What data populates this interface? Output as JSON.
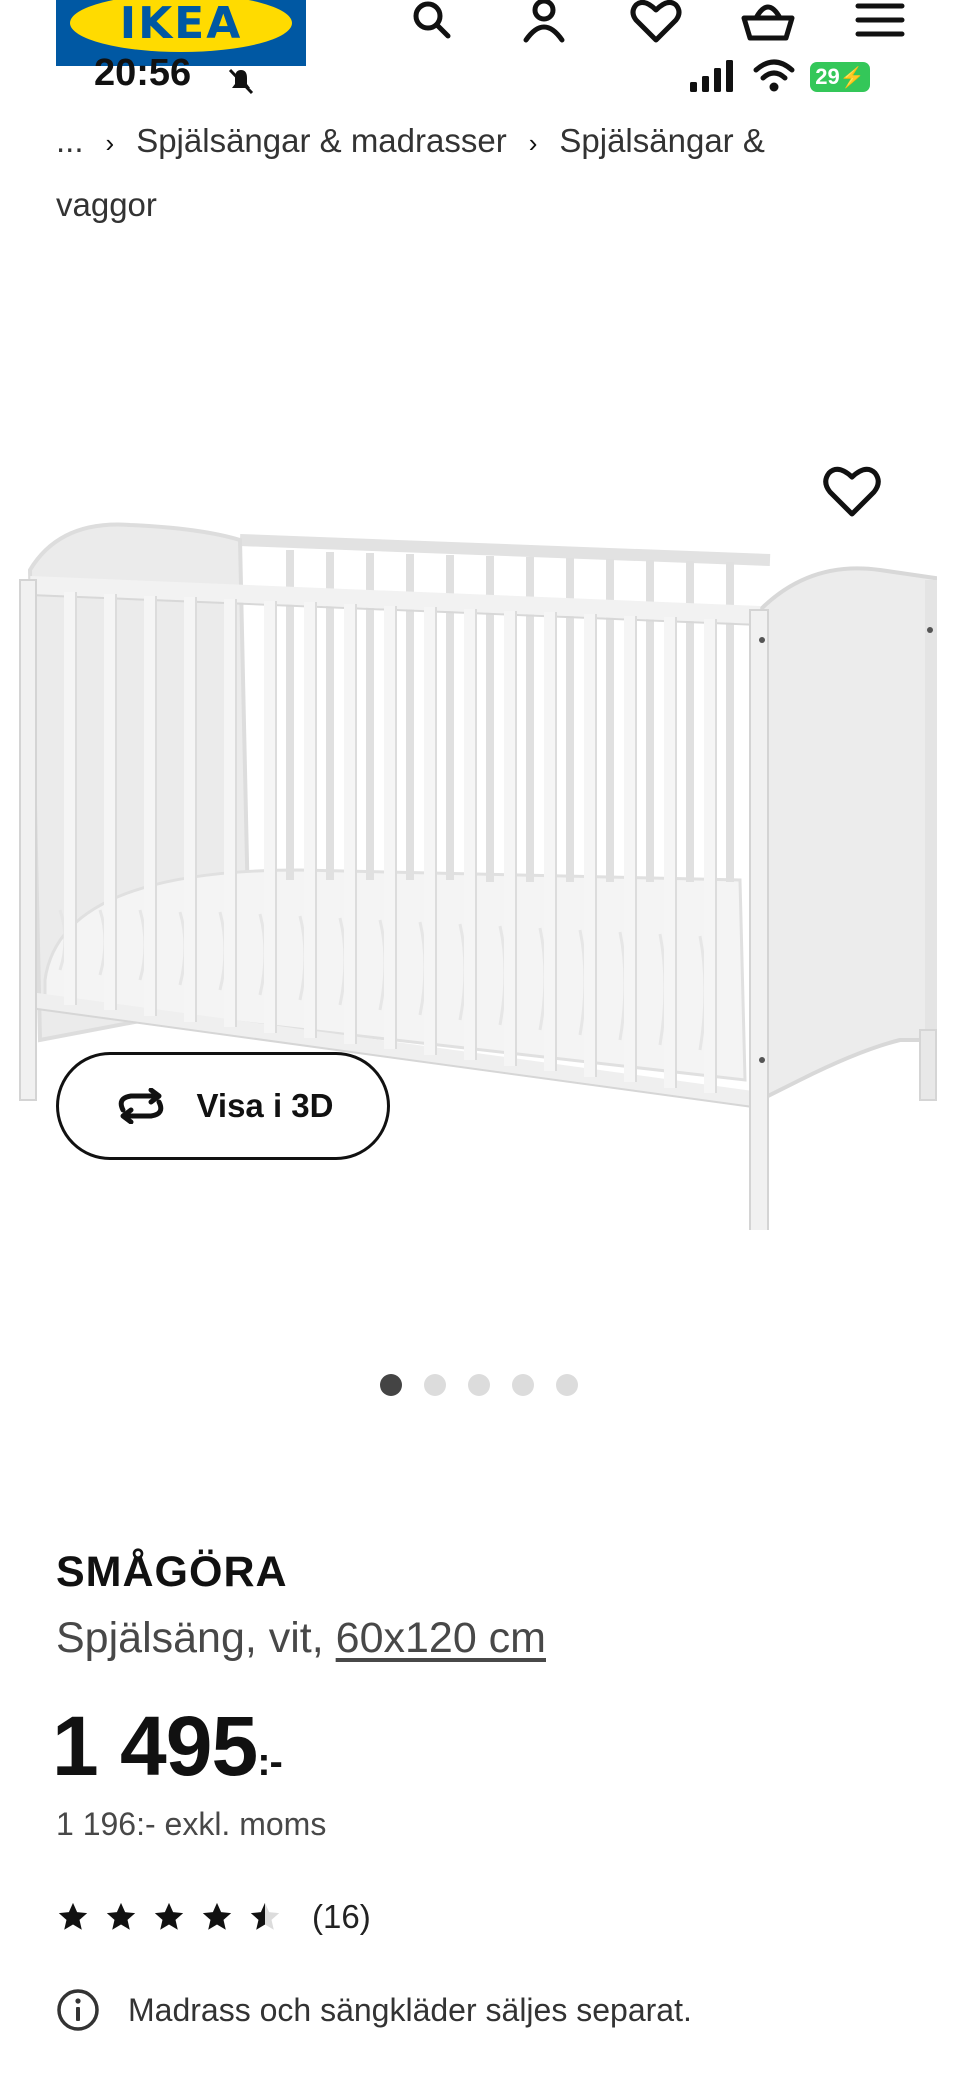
{
  "header": {
    "logo_text": "IKEA",
    "icons": [
      "search-icon",
      "user-icon",
      "heart-icon",
      "cart-icon",
      "menu-icon"
    ]
  },
  "status_bar": {
    "time": "20:56",
    "battery": "29"
  },
  "breadcrumb": {
    "ellipsis": "...",
    "items": [
      "Spjälsängar & madrasser",
      "Spjälsängar & vaggor"
    ]
  },
  "gallery": {
    "view_3d_label": "Visa i 3D",
    "total_images": 5,
    "active_index": 0
  },
  "product": {
    "name": "SMÅGÖRA",
    "description": "Spjälsäng, vit,",
    "size": "60x120 cm",
    "price": "1 495",
    "price_suffix": ":-",
    "price_excl_vat": "1 196:- exkl. moms",
    "rating_value": 4.5,
    "rating_max": 5,
    "review_count": "(16)",
    "notice": "Madrass och sängkläder säljes separat."
  },
  "colors": {
    "ikea_blue": "#0058a3",
    "ikea_yellow": "#ffdb00",
    "battery_green": "#34c759"
  }
}
